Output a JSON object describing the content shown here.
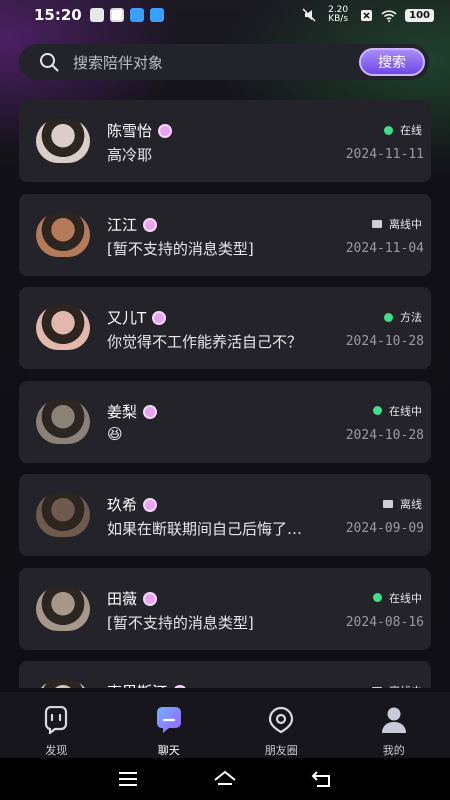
{
  "status_bar": {
    "time": "15:20",
    "net_speed": "2.20 KB/s",
    "battery": "100"
  },
  "search": {
    "placeholder": "搜索陪伴对象",
    "button_label": "搜索"
  },
  "chats": [
    {
      "name": "陈雪怡",
      "message": "高冷耶",
      "status": "在线",
      "status_icon": "online-dot",
      "date": "2024-11-11",
      "avatar_color": "#d9cfc8"
    },
    {
      "name": "江江",
      "message": "[暂不支持的消息类型]",
      "status": "离线中",
      "status_icon": "offline-cup",
      "date": "2024-11-04",
      "avatar_color": "#b47a5a"
    },
    {
      "name": "又儿T",
      "message": "你觉得不工作能养活自己不？",
      "status": "方法",
      "status_icon": "online-dot",
      "date": "2024-10-28",
      "avatar_color": "#e2b8ac"
    },
    {
      "name": "姜梨",
      "message": "😆",
      "status": "在线中",
      "status_icon": "online-dot",
      "date": "2024-10-28",
      "avatar_color": "#8a8178"
    },
    {
      "name": "玖希",
      "message": "如果在断联期间自己后悔了…",
      "status": "离线",
      "status_icon": "offline-monitor",
      "date": "2024-09-09",
      "avatar_color": "#6e5a4e"
    },
    {
      "name": "田薇",
      "message": "[暂不支持的消息类型]",
      "status": "在线中",
      "status_icon": "online-dot",
      "date": "2024-08-16",
      "avatar_color": "#a7978a"
    },
    {
      "name": "克里斯汀",
      "message": "",
      "status": "离线中",
      "status_icon": "offline-cup",
      "date": "",
      "avatar_color": "#cfc3bb"
    }
  ],
  "bottom_nav": [
    {
      "label": "发现",
      "icon": "discover-icon",
      "active": false
    },
    {
      "label": "聊天",
      "icon": "chat-icon",
      "active": true
    },
    {
      "label": "朋友圈",
      "icon": "moments-icon",
      "active": false
    },
    {
      "label": "我的",
      "icon": "profile-icon",
      "active": false
    }
  ],
  "colors": {
    "accent": "#8b63f0",
    "online": "#3ee08a",
    "card_bg": "#24232a"
  }
}
